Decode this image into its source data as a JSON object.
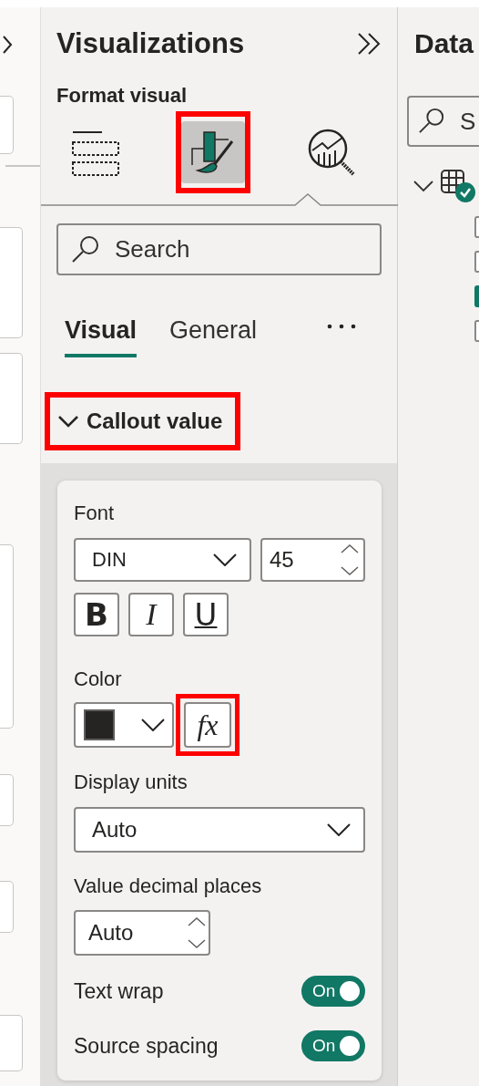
{
  "visualizations": {
    "title": "Visualizations",
    "subtitle": "Format visual",
    "view_tabs": [
      {
        "kind": "build",
        "selected": false,
        "highlighted": false
      },
      {
        "kind": "format",
        "selected": true,
        "highlighted": true
      },
      {
        "kind": "analytics",
        "selected": false,
        "highlighted": false
      }
    ],
    "search": {
      "placeholder": "Search"
    },
    "tabs": [
      {
        "label": "Visual",
        "selected": true
      },
      {
        "label": "General",
        "selected": false
      }
    ],
    "section": {
      "title": "Callout value",
      "expanded": true,
      "highlighted": true
    },
    "card": {
      "font_label": "Font",
      "font_family": "DIN",
      "font_size": "45",
      "styles": [
        {
          "kind": "bold",
          "label": "B"
        },
        {
          "kind": "italic",
          "label": "I"
        },
        {
          "kind": "underline",
          "label": "U"
        }
      ],
      "color_label": "Color",
      "color": "#252423",
      "fx": {
        "label": "fx",
        "highlighted": true
      },
      "display_units_label": "Display units",
      "display_units": "Auto",
      "decimal_label": "Value decimal places",
      "decimal": "Auto",
      "toggles": [
        {
          "label": "Text wrap",
          "state": "On",
          "on": true
        },
        {
          "label": "Source spacing",
          "state": "On",
          "on": true
        }
      ]
    }
  },
  "data_pane": {
    "title": "Data",
    "search": {
      "placeholder": "S"
    },
    "tree": [
      {
        "expanded": true,
        "children": [
          {
            "checked": false
          },
          {
            "checked": false
          },
          {
            "checked": true
          },
          {
            "checked": false
          }
        ]
      }
    ]
  }
}
